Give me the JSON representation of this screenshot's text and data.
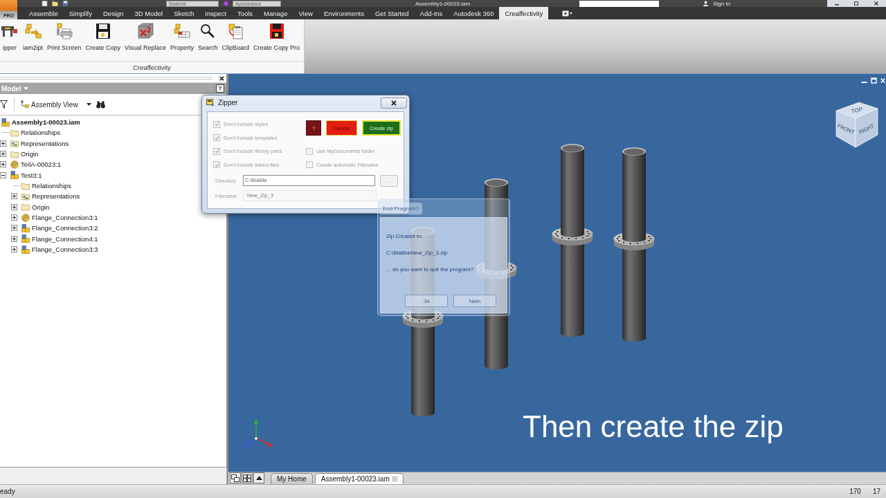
{
  "app_button": {
    "label": "PRO"
  },
  "quick_access": {
    "material": "Material",
    "appearance": "Appearance",
    "title": "Assembly1-00023.iam",
    "sign_in": "Sign In"
  },
  "ribbon_tabs": [
    {
      "label": "Assemble",
      "selected": false
    },
    {
      "label": "Simplify",
      "selected": false
    },
    {
      "label": "Design",
      "selected": false
    },
    {
      "label": "3D Model",
      "selected": false
    },
    {
      "label": "Sketch",
      "selected": false
    },
    {
      "label": "Inspect",
      "selected": false
    },
    {
      "label": "Tools",
      "selected": false
    },
    {
      "label": "Manage",
      "selected": false
    },
    {
      "label": "View",
      "selected": false
    },
    {
      "label": "Environments",
      "selected": false
    },
    {
      "label": "Get Started",
      "selected": false
    },
    {
      "label": "Add-Ins",
      "selected": false
    },
    {
      "label": "Autodesk 360",
      "selected": false
    },
    {
      "label": "Creaffectivity",
      "selected": true
    }
  ],
  "ribbon_panel": {
    "title": "Creaffectivity",
    "buttons": [
      {
        "label": "ipper",
        "kind": "zipper"
      },
      {
        "label": "iam2ipt",
        "kind": "convert"
      },
      {
        "label": "Print Screen",
        "kind": "print"
      },
      {
        "label": "Create Copy",
        "kind": "copy"
      },
      {
        "label": "Visual Replace",
        "kind": "replace"
      },
      {
        "label": "Property",
        "kind": "property"
      },
      {
        "label": "Search",
        "kind": "search"
      },
      {
        "label": "ClipBoard",
        "kind": "clipboard"
      },
      {
        "label": "Create Copy Pro",
        "kind": "copy-pro"
      }
    ]
  },
  "browser": {
    "title": "Model",
    "help": "?",
    "view": "Assembly View",
    "tree": [
      {
        "label": "Assembly1-00023.iam",
        "kind": "assembly",
        "children": [
          {
            "label": "Relationships",
            "kind": "folder"
          },
          {
            "label": "Representations",
            "kind": "representations",
            "expanded": false
          },
          {
            "label": "Origin",
            "kind": "folder",
            "expanded": false
          },
          {
            "label": "TeilA-00023:1",
            "kind": "adaptive",
            "expanded": false
          },
          {
            "label": "Test3:1",
            "kind": "assembly",
            "expanded": true,
            "children": [
              {
                "label": "Relationships",
                "kind": "folder"
              },
              {
                "label": "Representations",
                "kind": "representations",
                "expanded": false
              },
              {
                "label": "Origin",
                "kind": "folder",
                "expanded": false
              },
              {
                "label": "Flange_Connection3:1",
                "kind": "adaptive",
                "expanded": false
              },
              {
                "label": "Flange_Connection3:2",
                "kind": "assembly",
                "expanded": false
              },
              {
                "label": "Flange_Connection4:1",
                "kind": "assembly",
                "expanded": false
              },
              {
                "label": "Flange_Connection3:3",
                "kind": "assembly",
                "expanded": false
              }
            ]
          }
        ]
      }
    ]
  },
  "zipper_dialog": {
    "title": "Zipper",
    "options": [
      {
        "label": "Don't include styles",
        "checked": true
      },
      {
        "label": "Don't include templates",
        "checked": true
      },
      {
        "label": "Don't include library parts",
        "checked": true
      },
      {
        "label": "Don't include linked files",
        "checked": true
      }
    ],
    "extra_options": [
      {
        "label": "Use MyDocuments folder",
        "checked": false
      },
      {
        "label": "Create automatic Filename",
        "checked": false
      }
    ],
    "buttons": [
      {
        "label": "?",
        "kind": "help",
        "color": "#7a1414"
      },
      {
        "label": "Cancel",
        "kind": "cancel",
        "color": "#e41d15"
      },
      {
        "label": "Create zip",
        "kind": "confirm",
        "color": "#1c6e1c"
      }
    ],
    "directory": {
      "label": "Directory",
      "value": "C:\\BlaBla"
    },
    "browse": "...",
    "filename": {
      "label": "Filename",
      "value": "New_Zip_3"
    }
  },
  "end_dialog": {
    "title": "End Program?",
    "lines": [
      "Zip Created in:",
      "C:\\BlaBla\\New_Zip_3.zip",
      "... do you want to quit the program?"
    ],
    "buttons": [
      "Ja",
      "Nein"
    ]
  },
  "view_cube": {
    "faces": [
      "TOP",
      "FRONT",
      "RIGHT"
    ]
  },
  "caption": "Then create the zip",
  "document_tabs": [
    {
      "label": "My Home",
      "selected": false
    },
    {
      "label": "Assembly1-00023.iam",
      "selected": true
    }
  ],
  "status_bar": {
    "message": "eady",
    "values": [
      "170",
      "17"
    ]
  }
}
